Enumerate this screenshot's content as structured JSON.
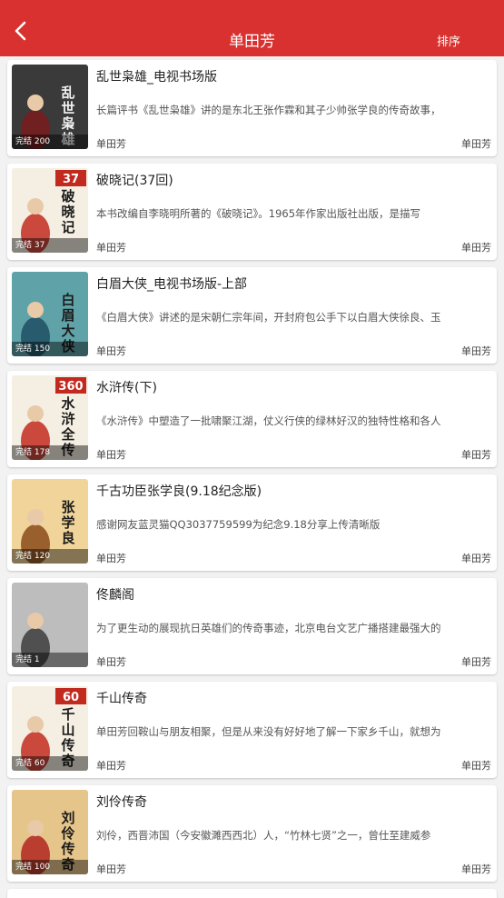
{
  "header": {
    "title": "单田芳",
    "sort_label": "排序",
    "color": "#d8312f"
  },
  "items": [
    {
      "title": "乱世枭雄_电视书场版",
      "desc": "长篇评书《乱世枭雄》讲的是东北王张作霖和其子少帅张学良的传奇故事，",
      "status": "完结 200",
      "author": "单田芳",
      "anchor": "单田芳",
      "cover_text": "乱世枭雄",
      "cover_bg": "#3a3a3a",
      "cover_accent": "#7a1c1c"
    },
    {
      "title": "破晓记(37回)",
      "desc": "本书改编自李晓明所著的《破晓记》。1965年作家出版社出版，是描写",
      "status": "完结 37",
      "author": "单田芳",
      "anchor": "单田芳",
      "cover_text": "破晓记",
      "cover_badge": "37",
      "cover_bg": "#f4efe2",
      "cover_accent": "#c22a1f"
    },
    {
      "title": "白眉大侠_电视书场版-上部",
      "desc": "《白眉大侠》讲述的是宋朝仁宗年间，开封府包公手下以白眉大侠徐良、玉",
      "status": "完结 150",
      "author": "单田芳",
      "anchor": "单田芳",
      "cover_text": "白眉大侠",
      "cover_bg": "#5fa3a8",
      "cover_accent": "#1d4f63"
    },
    {
      "title": "水浒传(下)",
      "desc": "《水浒传》中塑造了一批啸聚江湖，仗义行侠的绿林好汉的独特性格和各人",
      "status": "完结 178",
      "author": "单田芳",
      "anchor": "单田芳",
      "cover_text": "水浒全传",
      "cover_badge": "360",
      "cover_bg": "#f4efe2",
      "cover_accent": "#c22a1f"
    },
    {
      "title": "千古功臣张学良(9.18纪念版)",
      "desc": "感谢网友蓝灵猫QQ3037759599为纪念9.18分享上传清晰版",
      "status": "完结 120",
      "author": "单田芳",
      "anchor": "单田芳",
      "cover_text": "张学良",
      "cover_bg": "#f1d49a",
      "cover_accent": "#8a4b1a"
    },
    {
      "title": "佟麟阁",
      "desc": "为了更生动的展现抗日英雄们的传奇事迹，北京电台文艺广播搭建最强大的",
      "status": "完结 1",
      "author": "单田芳",
      "anchor": "单田芳",
      "cover_text": "",
      "cover_bg": "#bdbdbd",
      "cover_accent": "#3d3d3d"
    },
    {
      "title": "千山传奇",
      "desc": "单田芳回鞍山与朋友相聚，但是从来没有好好地了解一下家乡千山，就想为",
      "status": "完结 60",
      "author": "单田芳",
      "anchor": "单田芳",
      "cover_text": "千山传奇",
      "cover_badge": "60",
      "cover_bg": "#f4efe2",
      "cover_accent": "#c22a1f"
    },
    {
      "title": "刘伶传奇",
      "desc": "刘伶，西晋沛国（今安徽濉西西北）人，“竹林七贤”之一，曾仕至建威参",
      "status": "完结 100",
      "author": "单田芳",
      "anchor": "单田芳",
      "cover_text": "刘伶传奇",
      "cover_bg": "#e6c58a",
      "cover_accent": "#b0261e"
    }
  ]
}
